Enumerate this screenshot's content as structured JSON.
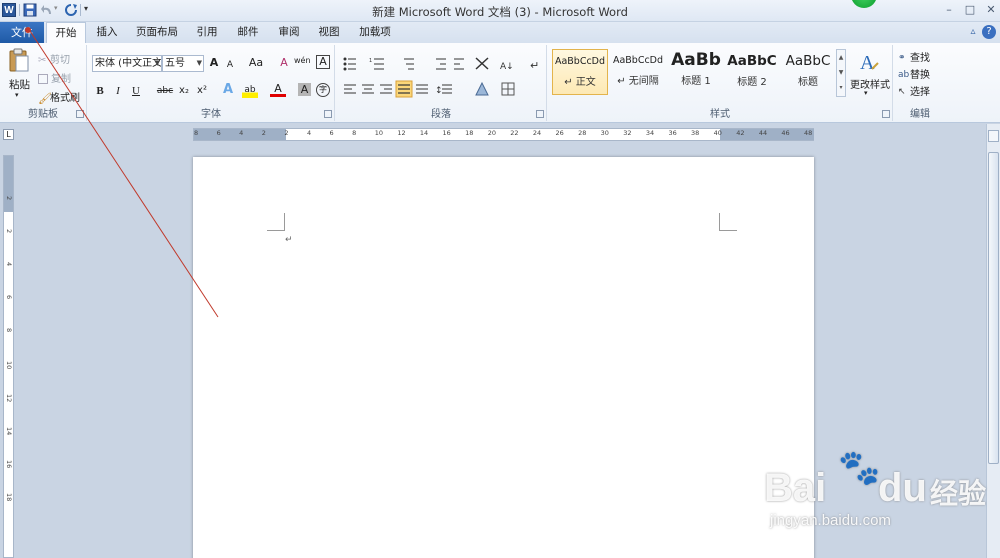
{
  "window": {
    "title": "新建 Microsoft Word 文档 (3)  -  Microsoft Word",
    "app_icon": "W",
    "qat_dropdown_glyph": "▾",
    "controls": {
      "minimize": "–",
      "maximize": "□",
      "close": "✕"
    }
  },
  "tabs": {
    "file": "文件",
    "items": [
      {
        "label": "开始",
        "active": true
      },
      {
        "label": "插入"
      },
      {
        "label": "页面布局"
      },
      {
        "label": "引用"
      },
      {
        "label": "邮件"
      },
      {
        "label": "审阅"
      },
      {
        "label": "视图"
      },
      {
        "label": "加载项"
      }
    ],
    "collapse_glyph": "▵",
    "help_glyph": "?"
  },
  "clipboard": {
    "paste": "粘贴",
    "paste_dropdown": "▾",
    "cut": "剪切",
    "copy": "复制",
    "format_painter": "格式刷",
    "label": "剪贴板"
  },
  "font": {
    "name": "宋体 (中文正文)",
    "size": "五号",
    "grow": "A",
    "shrink": "A",
    "change_case": "Aa",
    "clear_format": "A",
    "phonetic": "wén",
    "char_border": "A",
    "bold": "B",
    "italic": "I",
    "underline": "U",
    "strike": "abc",
    "subscript": "x₂",
    "superscript": "x²",
    "text_effect": "A",
    "highlight": "ab",
    "font_color": "A",
    "char_shading": "A",
    "enclose": "字",
    "label": "字体"
  },
  "paragraph": {
    "label": "段落"
  },
  "styles": {
    "items": [
      {
        "sample": "AaBbCcDd",
        "name": "↵ 正文",
        "selected": true
      },
      {
        "sample": "AaBbCcDd",
        "name": "↵ 无间隔"
      },
      {
        "sample": "AaBb",
        "name": "标题 1"
      },
      {
        "sample": "AaBbC",
        "name": "标题 2"
      },
      {
        "sample": "AaBbC",
        "name": "标题"
      }
    ],
    "change_styles": "更改样式",
    "change_styles_dropdown": "▾",
    "label": "样式"
  },
  "editing": {
    "find": "查找",
    "replace": "替换",
    "select": "选择",
    "label": "编辑"
  },
  "ruler": {
    "horizontal": [
      "8",
      "6",
      "4",
      "2",
      "2",
      "4",
      "6",
      "8",
      "10",
      "12",
      "14",
      "16",
      "18",
      "20",
      "22",
      "24",
      "26",
      "28",
      "30",
      "32",
      "34",
      "36",
      "38",
      "40",
      "42",
      "44",
      "46",
      "48"
    ],
    "vertical": [
      "2",
      "2",
      "4",
      "6",
      "8",
      "10",
      "12",
      "14",
      "16",
      "18"
    ]
  },
  "document": {
    "paragraph_mark": "↵"
  },
  "watermark": {
    "brand": "Bai",
    "brand_suffix": "du",
    "cn": "经验",
    "url": "jingyan.baidu.com"
  },
  "colors": {
    "file_tab": "#2a66b5",
    "accent": "#2b579a",
    "annotation_line": "#c0392b"
  }
}
